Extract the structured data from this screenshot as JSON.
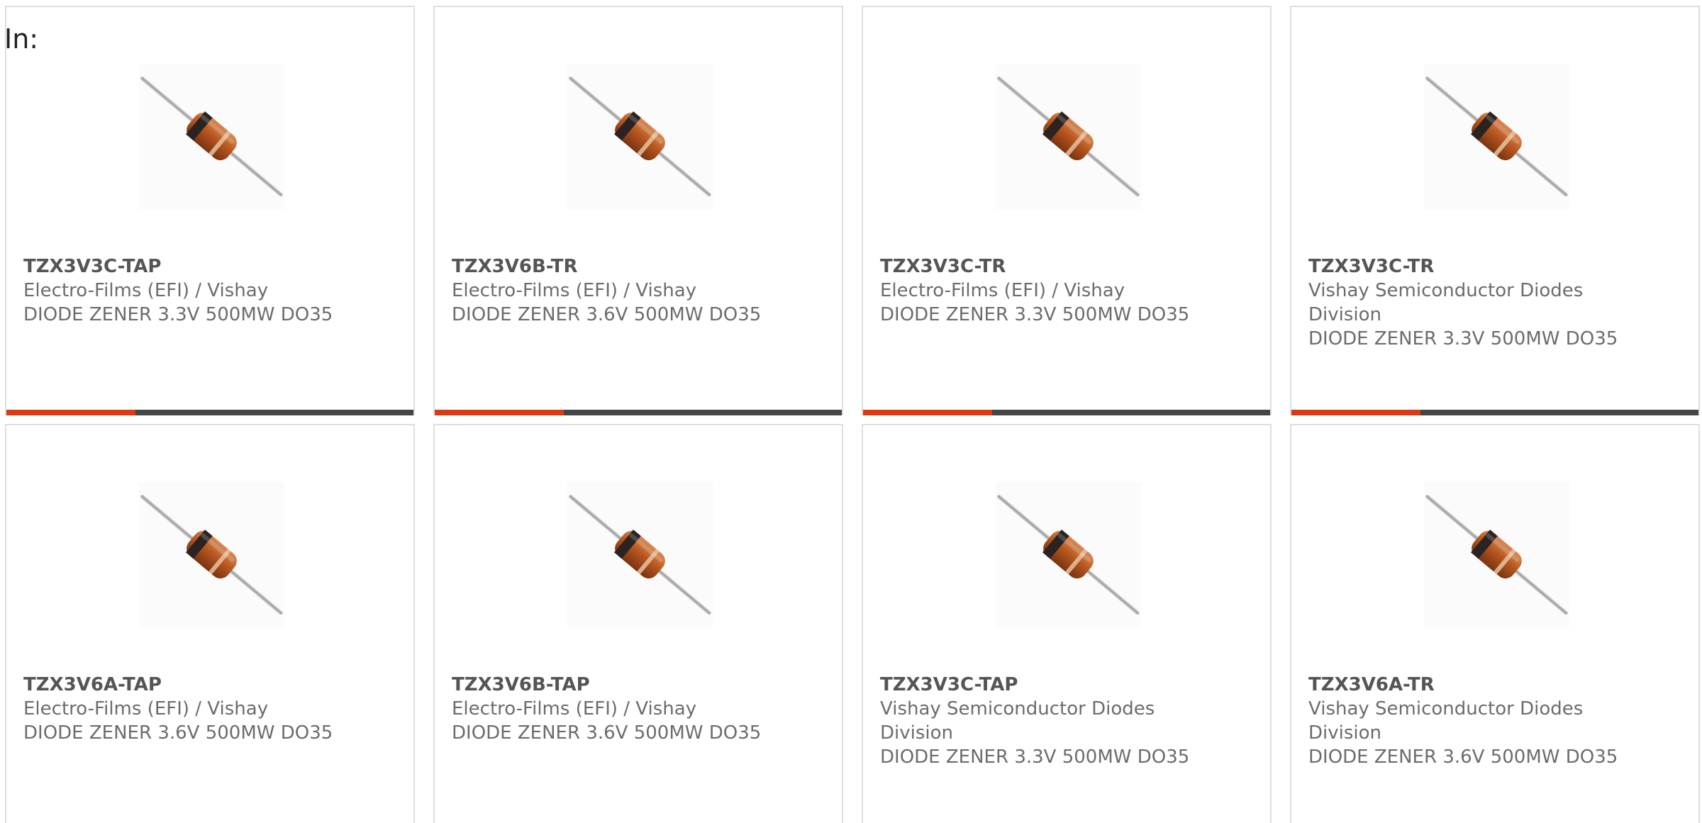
{
  "header": {
    "in_label": "In:"
  },
  "colors": {
    "accent": "#dd3a14",
    "bar": "#454545",
    "border": "#dedede",
    "text": "#6c6c6c"
  },
  "products": [
    {
      "part_number": "TZX3V3C-TAP",
      "manufacturer": "Electro-Films (EFI) / Vishay",
      "description": "DIODE ZENER 3.3V 500MW DO35",
      "image": "axial-diode-image"
    },
    {
      "part_number": "TZX3V6B-TR",
      "manufacturer": "Electro-Films (EFI) / Vishay",
      "description": "DIODE ZENER 3.6V 500MW DO35",
      "image": "axial-diode-image"
    },
    {
      "part_number": "TZX3V3C-TR",
      "manufacturer": "Electro-Films (EFI) / Vishay",
      "description": "DIODE ZENER 3.3V 500MW DO35",
      "image": "axial-diode-image"
    },
    {
      "part_number": "TZX3V3C-TR",
      "manufacturer": "Vishay Semiconductor Diodes Division",
      "description": "DIODE ZENER 3.3V 500MW DO35",
      "image": "axial-diode-image"
    },
    {
      "part_number": "TZX3V6A-TAP",
      "manufacturer": "Electro-Films (EFI) / Vishay",
      "description": "DIODE ZENER 3.6V 500MW DO35",
      "image": "axial-diode-image"
    },
    {
      "part_number": "TZX3V6B-TAP",
      "manufacturer": "Electro-Films (EFI) / Vishay",
      "description": "DIODE ZENER 3.6V 500MW DO35",
      "image": "axial-diode-image"
    },
    {
      "part_number": "TZX3V3C-TAP",
      "manufacturer": "Vishay Semiconductor Diodes Division",
      "description": "DIODE ZENER 3.3V 500MW DO35",
      "image": "axial-diode-image"
    },
    {
      "part_number": "TZX3V6A-TR",
      "manufacturer": "Vishay Semiconductor Diodes Division",
      "description": "DIODE ZENER 3.6V 500MW DO35",
      "image": "axial-diode-image"
    }
  ]
}
